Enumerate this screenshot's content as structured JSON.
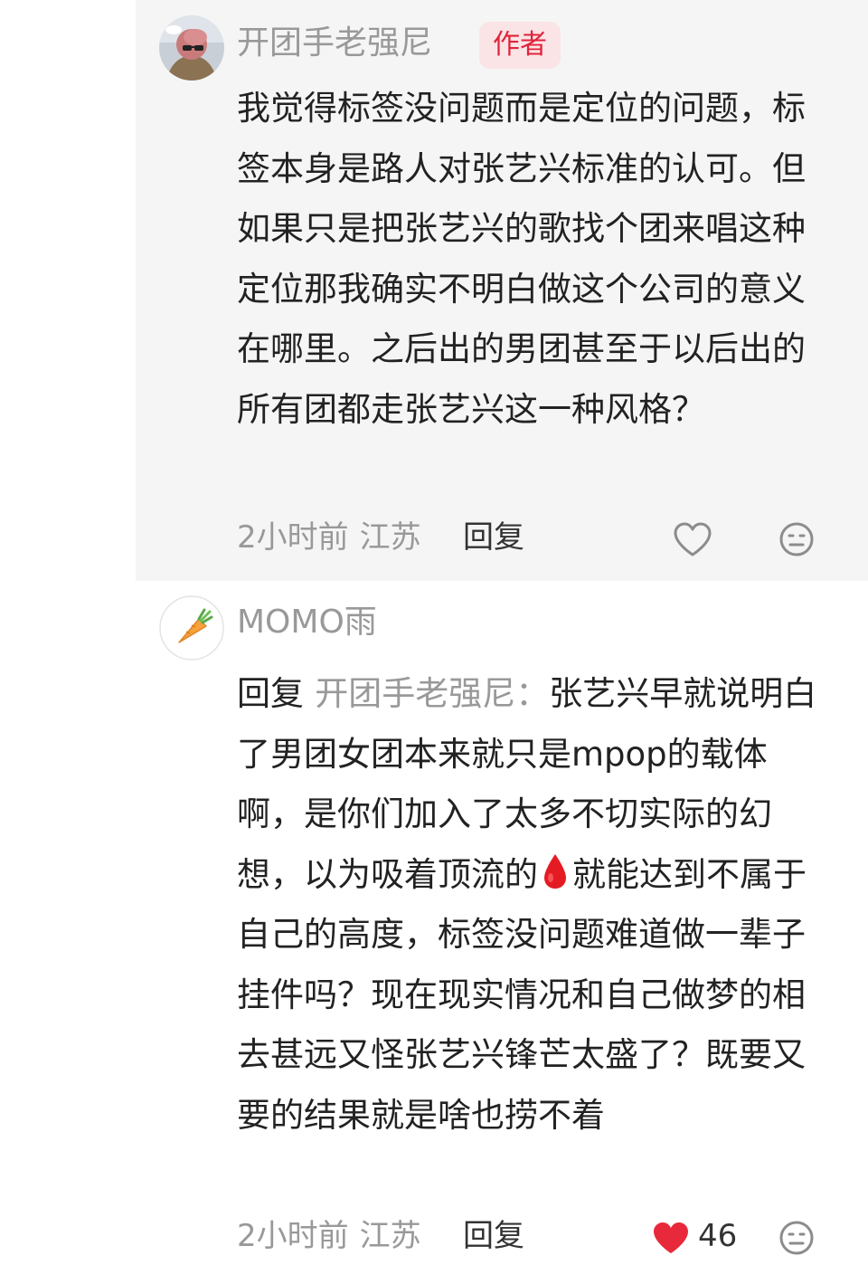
{
  "comments": [
    {
      "username": "开团手老强尼",
      "badge": "作者",
      "text": "我觉得标签没问题而是定位的问题，标签本身是路人对张艺兴标准的认可。但如果只是把张艺兴的歌找个团来唱这种定位那我确实不明白做这个公司的意义在哪里。之后出的男团甚至于以后出的所有团都走张艺兴这一种风格？",
      "time": "2小时前",
      "location": "江苏",
      "reply_label": "回复",
      "liked": false,
      "avatar_icon": "person-with-sunglasses-avatar",
      "like_icon": "heart-outline-icon",
      "dislike_icon": "neutral-face-icon"
    },
    {
      "username": "MOMO雨",
      "reply_prefix": "回复",
      "reply_to": "开团手老强尼：",
      "text_part1": "张艺兴早就说明白了男团女团本来就只是mpop的载体啊，是你们加入了太多不切实际的幻想，以为吸着顶流的",
      "emoji_icon": "blood-drop-icon",
      "text_part2": "就能达到不属于自己的高度，标签没问题难道做一辈子挂件吗？现在现实情况和自己做梦的相去甚远又怪张艺兴锋芒太盛了？既要又要的结果就是啥也捞不着",
      "time": "2小时前",
      "location": "江苏",
      "reply_label": "回复",
      "liked": true,
      "like_count": "46",
      "avatar_icon": "carrot-avatar",
      "like_icon": "heart-filled-icon",
      "dislike_icon": "neutral-face-icon"
    }
  ],
  "colors": {
    "author_badge_bg": "#fbe4e6",
    "author_badge_text": "#e0243a",
    "like_red": "#e8293c",
    "muted_text": "#999999"
  }
}
